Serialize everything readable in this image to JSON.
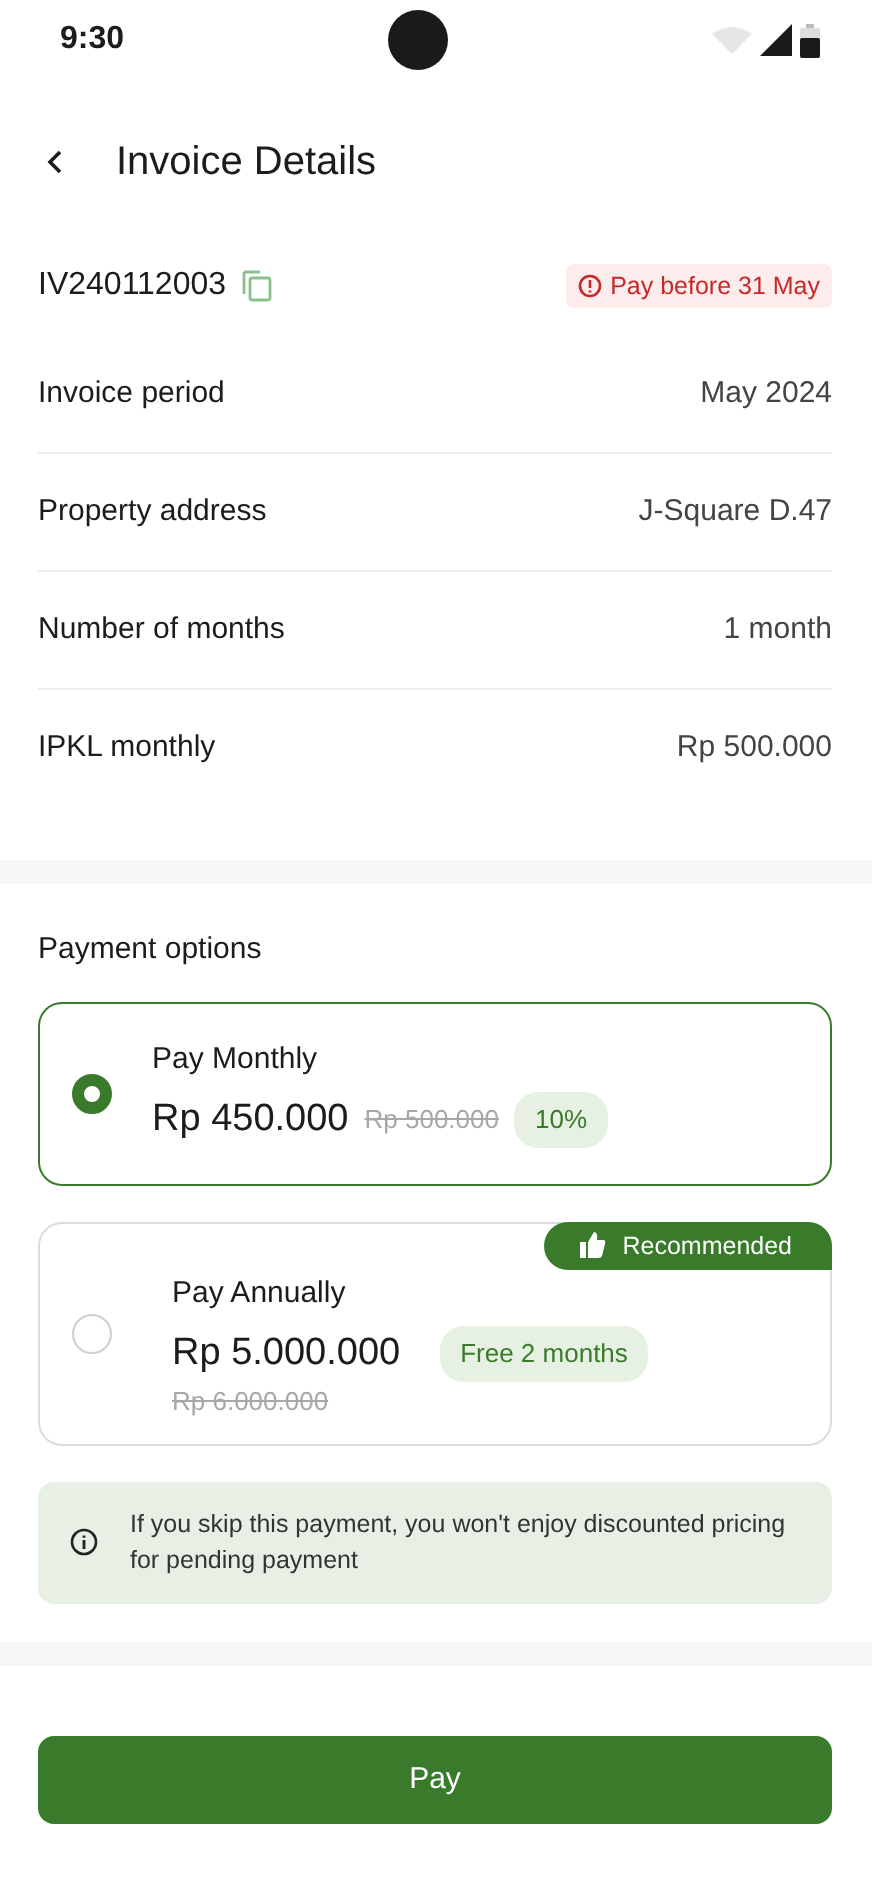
{
  "status_bar": {
    "time": "9:30"
  },
  "header": {
    "title": "Invoice Details"
  },
  "invoice": {
    "number": "IV240112003",
    "due_badge": "Pay before 31 May"
  },
  "details": [
    {
      "label": "Invoice period",
      "value": "May 2024"
    },
    {
      "label": "Property address",
      "value": "J-Square D.47"
    },
    {
      "label": "Number of months",
      "value": "1 month"
    },
    {
      "label": "IPKL monthly",
      "value": "Rp 500.000"
    }
  ],
  "payment_options": {
    "title": "Payment options",
    "options": [
      {
        "kind": "inline",
        "name": "Pay Monthly",
        "price": "Rp 450.000",
        "original_price": "Rp 500.000",
        "badge": "10%",
        "selected": true
      },
      {
        "kind": "stacked",
        "name": "Pay Annually",
        "price": "Rp 5.000.000",
        "original_price": "Rp 6.000.000",
        "badge": "Free 2 months",
        "ribbon": "Recommended",
        "selected": false
      }
    ]
  },
  "notice": "If you skip this payment, you won't enjoy discounted pricing for pending payment",
  "pay_button": "Pay"
}
